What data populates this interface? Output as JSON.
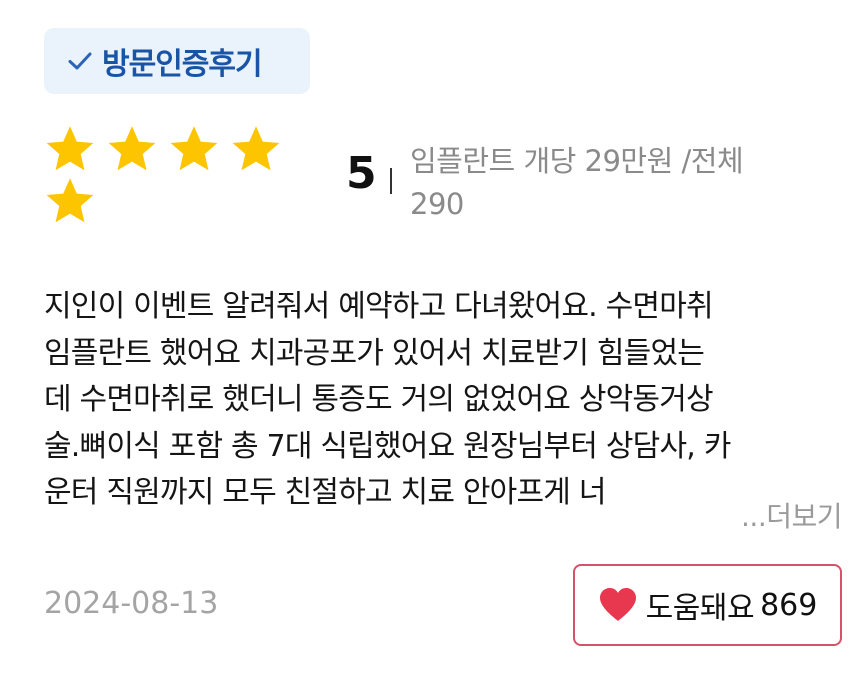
{
  "badge": {
    "icon": "check-icon",
    "label": "방문인증후기",
    "text_color": "#1a54a6",
    "bg_color": "#eaf3fc"
  },
  "rating": {
    "stars": 5,
    "max_stars": 5,
    "star_color": "#fdc400",
    "score": "5",
    "desc_line1": "임플란트 개당 29만원 /전체",
    "desc_line2": "290"
  },
  "review": {
    "lines": [
      "지인이 이벤트 알려줘서 예약하고 다녀왔어요. 수면마취",
      "임플란트 했어요 치과공포가 있어서 치료받기 힘들었는",
      "데 수면마취로 했더니 통증도 거의 없었어요 상악동거상",
      "술.뼈이식 포함 총 7대 식립했어요 원장님부터 상담사, 카",
      "운터 직원까지 모두 친절하고 치료 안아프게 너"
    ],
    "more_label": "...더보기"
  },
  "footer": {
    "date": "2024-08-13",
    "helpful_icon": "heart-icon",
    "helpful_label": "도움돼요",
    "helpful_count": "869",
    "accent_color": "#e8384f"
  }
}
